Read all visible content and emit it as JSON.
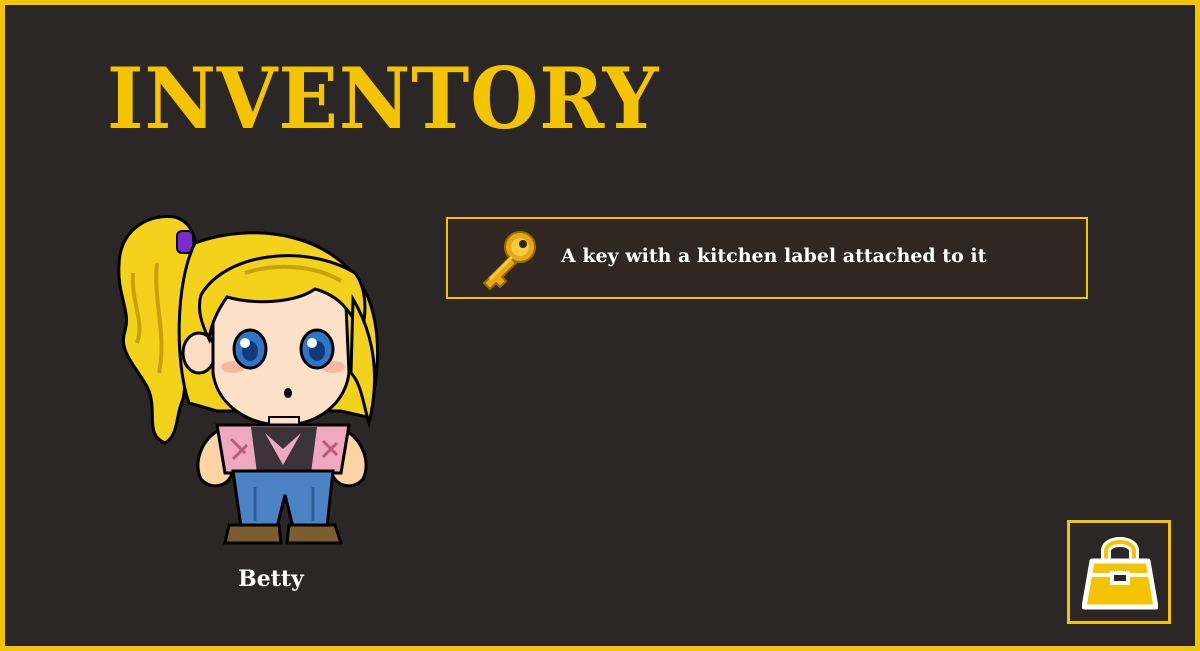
{
  "screen": {
    "title": "INVENTORY",
    "accent_color": "#f5c400",
    "background_color": "#2b2726"
  },
  "character": {
    "name": "Betty",
    "sprite": "pixel-art-girl-blonde-ponytail"
  },
  "inventory": {
    "items": [
      {
        "icon": "gold-key-icon",
        "description": "A key with a kitchen label attached to it"
      }
    ]
  },
  "controls": {
    "bag_icon": "bag-icon"
  }
}
